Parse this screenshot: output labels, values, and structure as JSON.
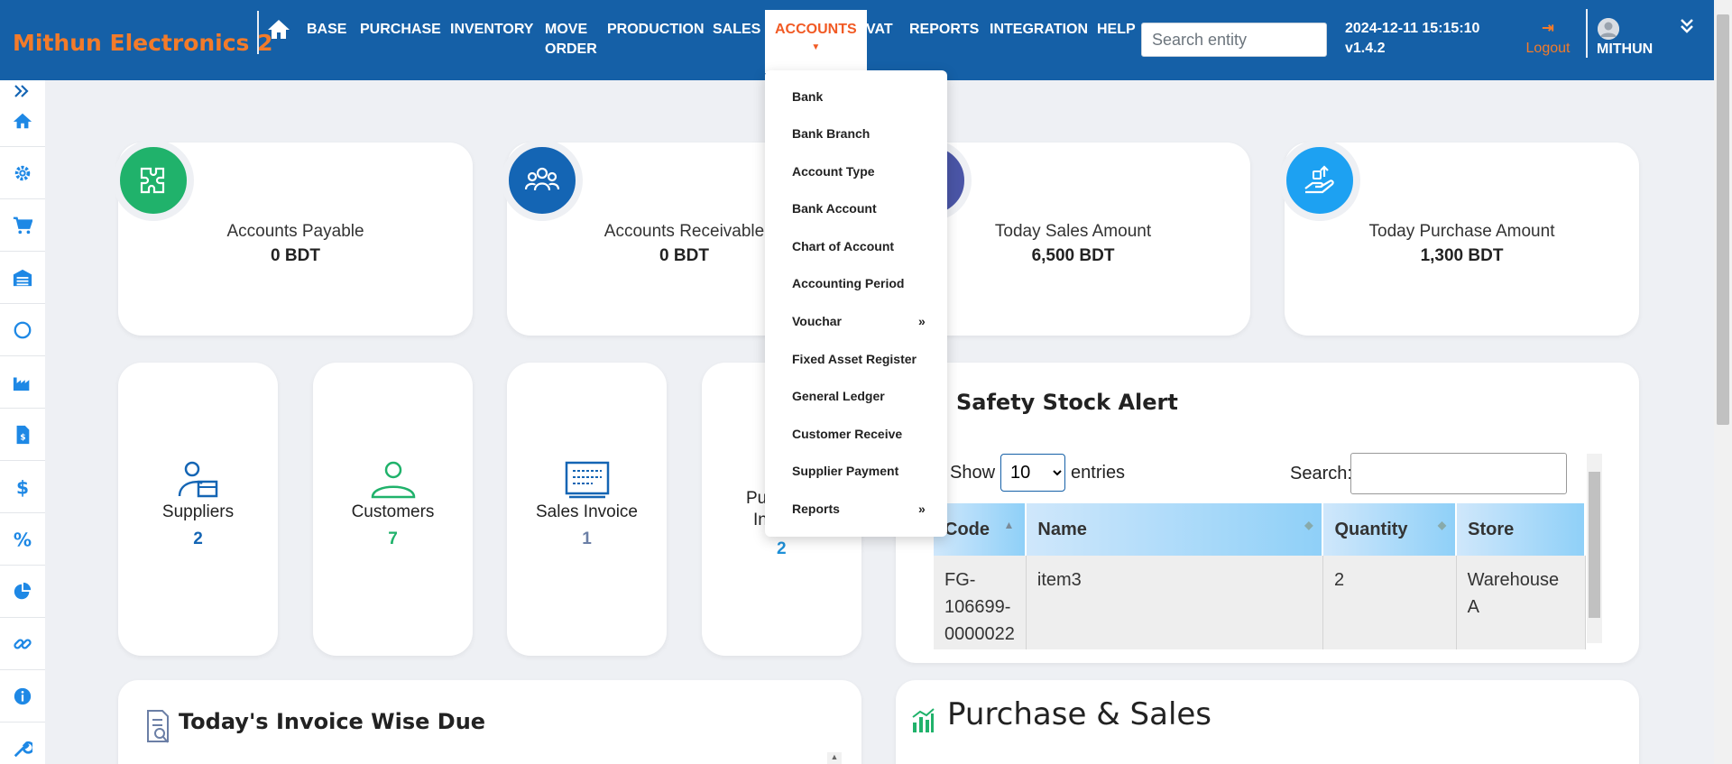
{
  "brand": "Mithun Electronics 2",
  "nav": {
    "items": [
      "BASE",
      "PURCHASE",
      "INVENTORY",
      "MOVE",
      "PRODUCTION",
      "SALES",
      "ACCOUNTS",
      "VAT",
      "REPORTS",
      "INTEGRATION",
      "HELP"
    ],
    "move_line2": "ORDER",
    "active": "ACCOUNTS"
  },
  "search": {
    "placeholder": "Search entity"
  },
  "datetime": "2024-12-11 15:15:10",
  "version": "v1.4.2",
  "logout_label": "Logout",
  "username": "MITHUN",
  "sidebar": {
    "icons": [
      "home-icon",
      "gear-icon",
      "cart-icon",
      "warehouse-icon",
      "circle-icon",
      "factory-icon",
      "invoice-icon",
      "dollar-icon",
      "percent-icon",
      "pie-chart-icon",
      "link-icon",
      "info-icon",
      "wrench-icon"
    ]
  },
  "stats": [
    {
      "label": "Accounts Payable",
      "value": "0 BDT",
      "color": "#20b26b",
      "icon": "puzzle-icon"
    },
    {
      "label": "Accounts Receivable",
      "value": "0 BDT",
      "color": "#1465b4",
      "icon": "users-icon"
    },
    {
      "label": "Today Sales Amount",
      "value": "6,500 BDT",
      "color": "#4a55a6",
      "icon": "sales-icon"
    },
    {
      "label": "Today Purchase Amount",
      "value": "1,300 BDT",
      "color": "#1da1f2",
      "icon": "hand-money-icon"
    }
  ],
  "mini_cards": [
    {
      "label": "Suppliers",
      "value": "2",
      "color": "#1465b4",
      "icon": "supplier-icon"
    },
    {
      "label": "Customers",
      "value": "7",
      "color": "#20b26b",
      "icon": "customer-icon"
    },
    {
      "label": "Sales Invoice",
      "value": "1",
      "color": "#6b7fa6",
      "icon": "invoice-board-icon"
    },
    {
      "label_line1": "Pu",
      "label_line2": "In",
      "value": "2",
      "color": "#1e90d8",
      "icon": "purchase-icon"
    }
  ],
  "safety_stock": {
    "title": "Safety Stock Alert",
    "show_label": "Show",
    "entries_value": "10",
    "entries_label": "entries",
    "search_label": "Search:",
    "columns": [
      "Code",
      "Name",
      "Quantity",
      "Store"
    ],
    "rows": [
      {
        "code_lines": [
          "FG-",
          "106699-",
          "0000022"
        ],
        "name": "item3",
        "quantity": "2",
        "store": "Warehouse A"
      }
    ]
  },
  "invoice_due": {
    "title": "Today's Invoice Wise Due"
  },
  "purchase_sales": {
    "title": "Purchase & Sales"
  },
  "accounts_menu": {
    "items": [
      "Bank",
      "Bank Branch",
      "Account Type",
      "Bank Account",
      "Chart of Account",
      "Accounting Period",
      "Vouchar",
      "Fixed Asset Register",
      "General Ledger",
      "Customer Receive",
      "Supplier Payment",
      "Reports"
    ],
    "submenu_arrow": "»"
  }
}
